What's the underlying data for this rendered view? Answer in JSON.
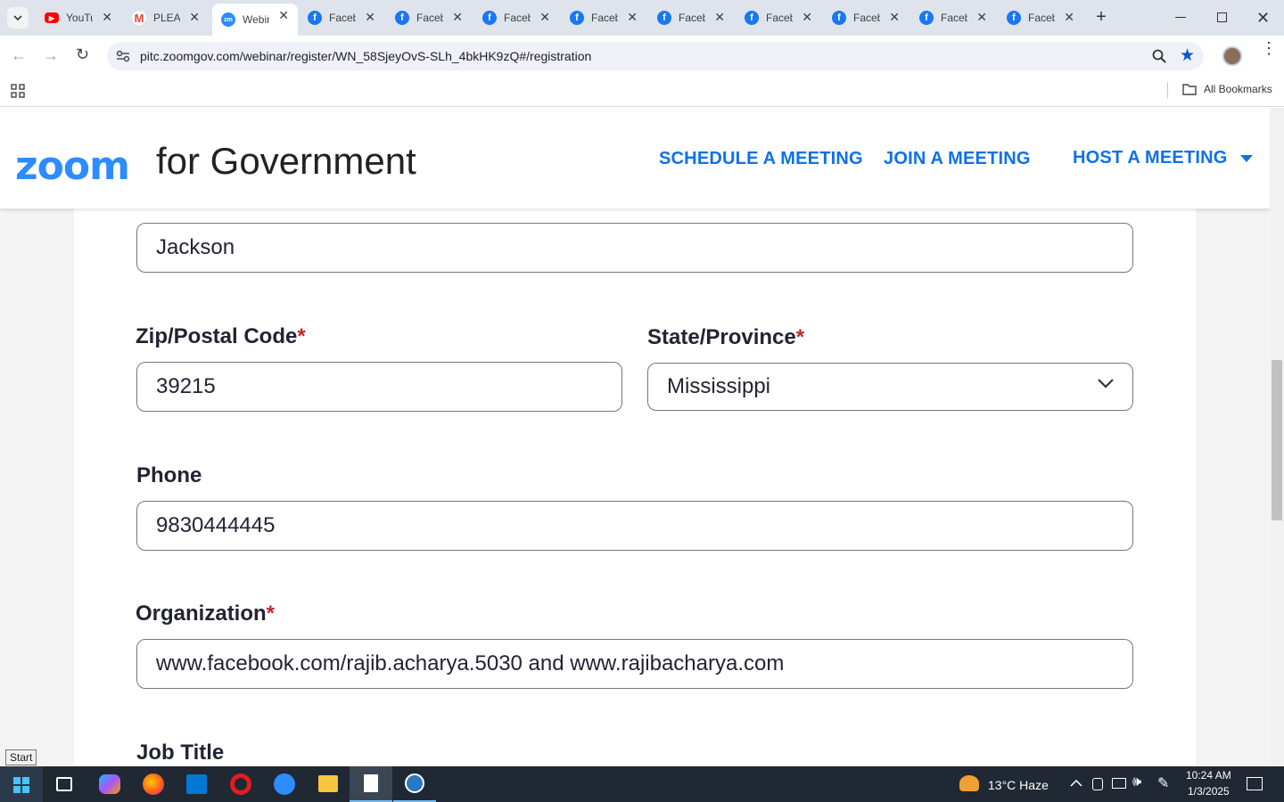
{
  "browser": {
    "tabs": [
      {
        "title": "YouTube",
        "icon": "youtube-icon"
      },
      {
        "title": "PLEASE",
        "icon": "gmail-icon"
      },
      {
        "title": "Webinar",
        "icon": "zoom-icon",
        "active": true
      },
      {
        "title": "Facebook",
        "icon": "facebook-icon"
      },
      {
        "title": "Facebook",
        "icon": "facebook-icon"
      },
      {
        "title": "Facebook",
        "icon": "facebook-icon"
      },
      {
        "title": "Facebook",
        "icon": "facebook-icon"
      },
      {
        "title": "Facebook",
        "icon": "facebook-icon"
      },
      {
        "title": "Facebook",
        "icon": "facebook-icon"
      },
      {
        "title": "Facebook",
        "icon": "facebook-icon"
      },
      {
        "title": "Facebook",
        "icon": "facebook-icon"
      },
      {
        "title": "Facebook",
        "icon": "facebook-icon"
      }
    ],
    "url": "pitc.zoomgov.com/webinar/register/WN_58SjeyOvS-SLh_4bkHK9zQ#/registration",
    "all_bookmarks": "All Bookmarks"
  },
  "header": {
    "logo": "zoom",
    "logo_sub": "for Government",
    "nav": {
      "schedule": "SCHEDULE A MEETING",
      "join": "JOIN A MEETING",
      "host": "HOST A MEETING"
    }
  },
  "form": {
    "city_value": "Jackson",
    "zip_label": "Zip/Postal Code",
    "zip_value": "39215",
    "state_label": "State/Province",
    "state_value": "Mississippi",
    "phone_label": "Phone",
    "phone_value": "9830444445",
    "org_label": "Organization",
    "org_value": "www.facebook.com/rajib.acharya.5030 and www.rajibacharya.com",
    "job_label": "Job Title",
    "required_mark": "*"
  },
  "taskbar": {
    "start_tooltip": "Start",
    "weather": "13°C  Haze",
    "time": "10:24 AM",
    "date": "1/3/2025"
  },
  "colors": {
    "accent": "#0e71eb",
    "zoom_blue": "#2d8cff",
    "required": "#c0262d"
  }
}
